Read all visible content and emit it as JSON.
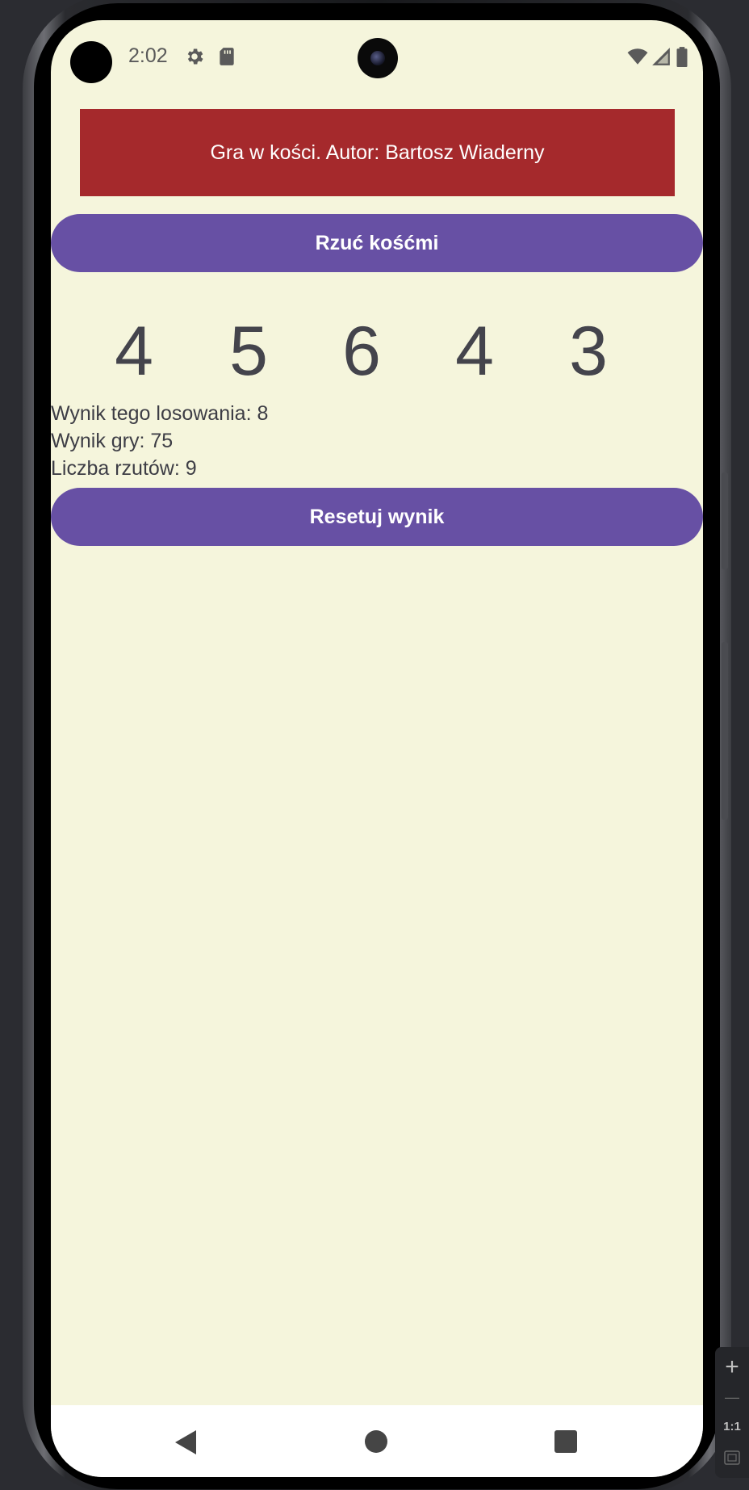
{
  "status_bar": {
    "time": "2:02",
    "icons": [
      "gear-icon",
      "sd-card-icon",
      "wifi-icon",
      "signal-icon",
      "battery-icon"
    ]
  },
  "app": {
    "header": "Gra w kości. Autor: Bartosz Wiaderny",
    "roll_button": "Rzuć kośćmi",
    "dice": [
      "4",
      "5",
      "6",
      "4",
      "3"
    ],
    "round_score": "Wynik tego losowania: 8",
    "game_score": "Wynik gry: 75",
    "roll_count": "Liczba rzutów: 9",
    "reset_button": "Resetuj wynik"
  },
  "emulator_controls": {
    "zoom_in": "+",
    "zoom_out": "—",
    "actual_size": "1:1"
  },
  "colors": {
    "background": "#f5f5dc",
    "header_bg": "#a5292c",
    "button_bg": "#6750a4",
    "text": "#3d3d45"
  }
}
